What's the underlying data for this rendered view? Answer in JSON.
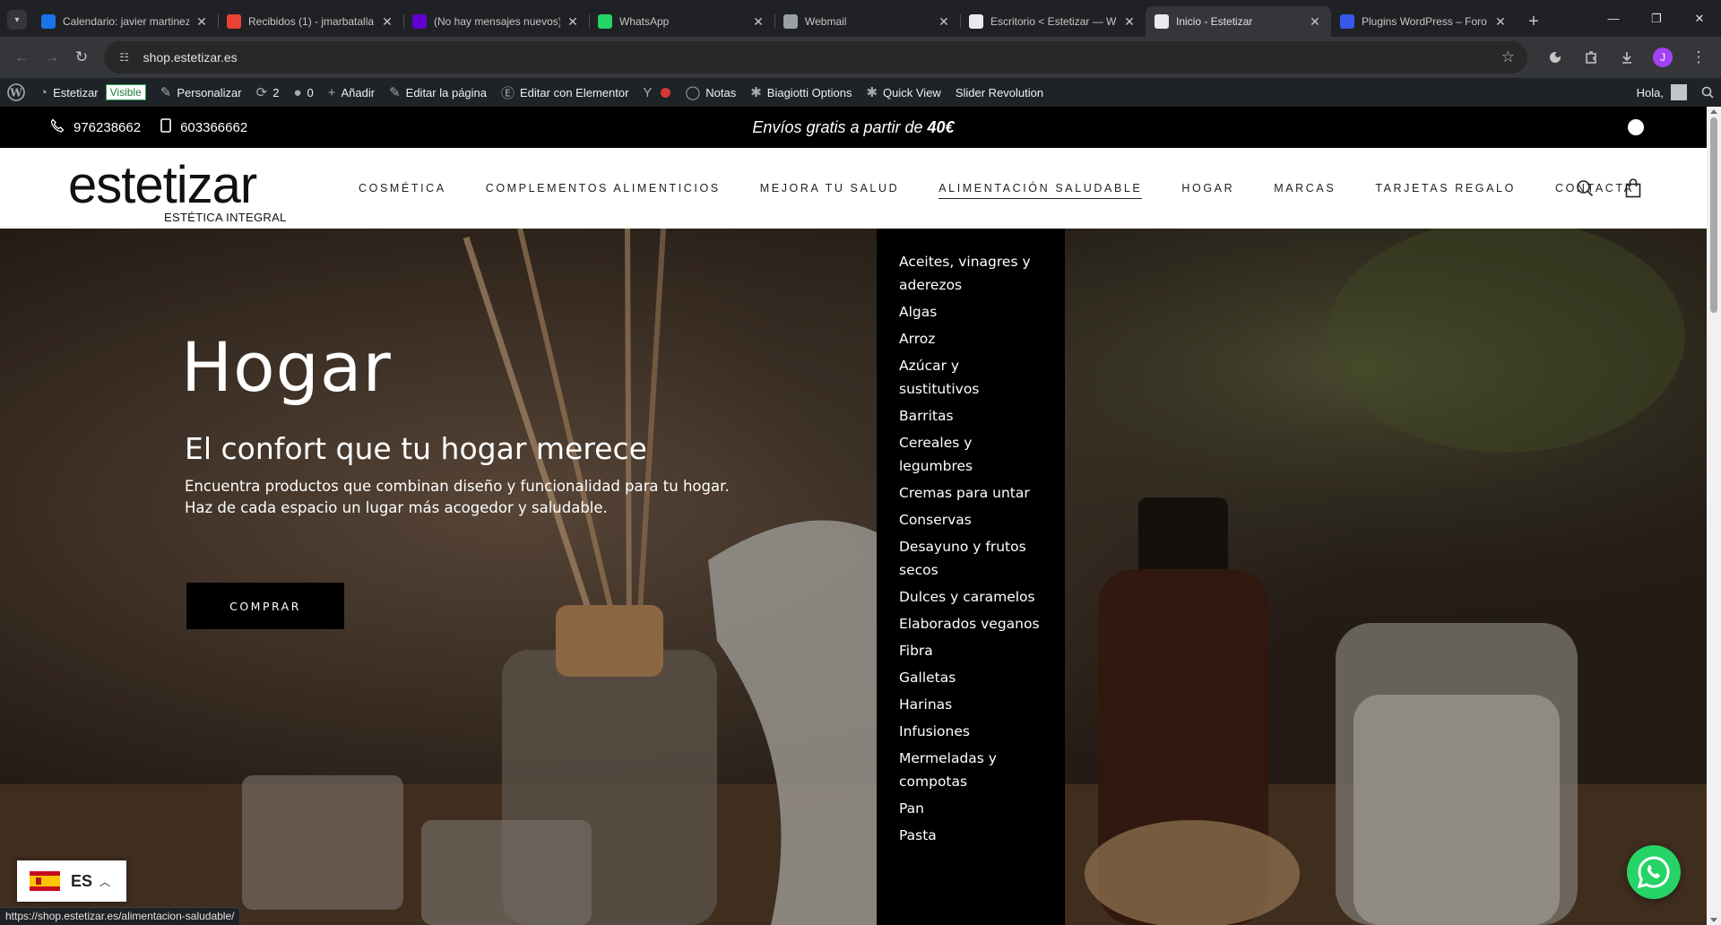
{
  "browser": {
    "tabs": [
      {
        "title": "Calendario: javier martinez",
        "icon": "calendar-icon",
        "color": "#1a73e8"
      },
      {
        "title": "Recibidos (1) - jmarbatalla",
        "icon": "gmail-icon",
        "color": "#ea4335"
      },
      {
        "title": "(No hay mensajes nuevos)",
        "icon": "yahoo-mail-icon",
        "color": "#6001d2"
      },
      {
        "title": "WhatsApp",
        "icon": "whatsapp-icon",
        "color": "#25d366"
      },
      {
        "title": "Webmail",
        "icon": "globe-icon",
        "color": "#9aa0a6"
      },
      {
        "title": "Escritorio < Estetizar — W",
        "icon": "page-icon",
        "color": "#e8eaed"
      },
      {
        "title": "Inicio - Estetizar",
        "icon": "page-icon",
        "color": "#e8eaed",
        "active": true
      },
      {
        "title": "Plugins WordPress – Foro",
        "icon": "wordpress-plugin-icon",
        "color": "#3858e9"
      }
    ],
    "url": "shop.estetizar.es",
    "profile_initial": "J",
    "status_url": "https://shop.estetizar.es/alimentacion-saludable/"
  },
  "adminbar": {
    "site_name": "Estetizar",
    "visible_badge": "Visible",
    "customize": "Personalizar",
    "updates_count": "2",
    "comments_count": "0",
    "add_new": "Añadir",
    "edit_page": "Editar la página",
    "edit_elementor": "Editar con Elementor",
    "notes": "Notas",
    "biagiotti": "Biagiotti Options",
    "quick_view": "Quick View",
    "slider": "Slider Revolution",
    "greeting": "Hola,"
  },
  "topbar": {
    "phone_1": "976238662",
    "phone_2": "603366662",
    "promo_text": "Envíos gratis a partir de",
    "promo_amount": "40€"
  },
  "header": {
    "logo_name": "estetizar",
    "logo_sub": "ESTÉTICA INTEGRAL",
    "nav": [
      {
        "label": "COSMÉTICA"
      },
      {
        "label": "COMPLEMENTOS ALIMENTICIOS"
      },
      {
        "label": "MEJORA TU SALUD"
      },
      {
        "label": "ALIMENTACIÓN SALUDABLE",
        "active": true
      },
      {
        "label": "HOGAR"
      },
      {
        "label": "MARCAS"
      },
      {
        "label": "TARJETAS REGALO"
      },
      {
        "label": "CONTACTA"
      }
    ]
  },
  "hero": {
    "title": "Hogar",
    "subtitle": "El confort que tu hogar merece",
    "description_1": "Encuentra productos que combinan diseño y funcionalidad para tu hogar.",
    "description_2": "Haz de cada espacio un lugar más acogedor y saludable.",
    "button": "COMPRAR"
  },
  "dropdown": {
    "items": [
      "Aceites, vinagres y aderezos",
      "Algas",
      "Arroz",
      "Azúcar y sustitutivos",
      "Barritas",
      "Cereales y legumbres",
      "Cremas para untar",
      "Conservas",
      "Desayuno y frutos secos",
      "Dulces y caramelos",
      "Elaborados veganos",
      "Fibra",
      "Galletas",
      "Harinas",
      "Infusiones",
      "Mermeladas y compotas",
      "Pan",
      "Pasta"
    ]
  },
  "language": {
    "code": "ES"
  }
}
